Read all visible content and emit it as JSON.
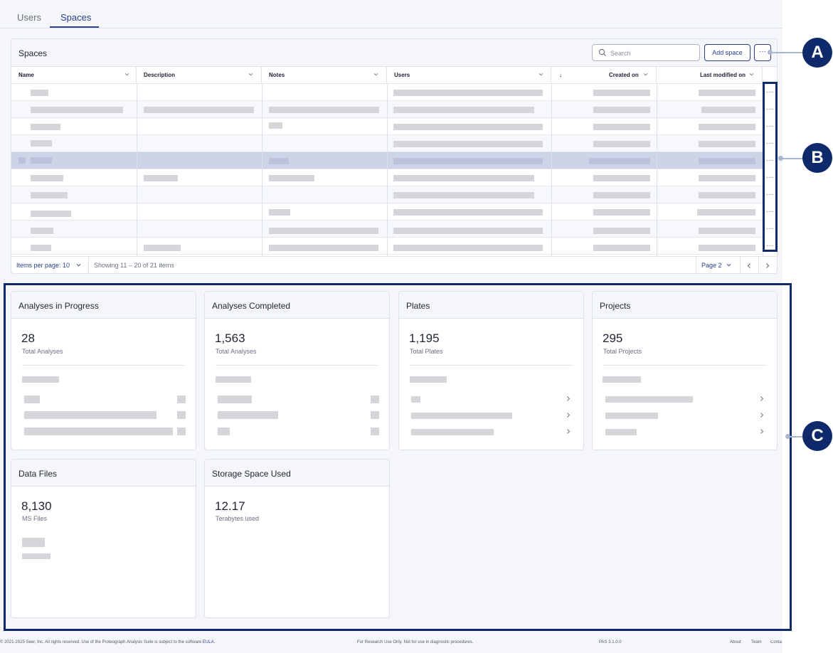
{
  "tabs": {
    "users": "Users",
    "spaces": "Spaces"
  },
  "spaces_panel": {
    "title": "Spaces",
    "search_placeholder": "Search",
    "add_space_label": "Add space",
    "more_label": "···",
    "columns": {
      "name": "Name",
      "description": "Description",
      "notes": "Notes",
      "users": "Users",
      "sort_indicator": "↓",
      "created_on": "Created on",
      "last_modified_on": "Last modified on"
    },
    "row_menu_label": "···",
    "items_per_page": "Items per page: 10",
    "showing": "Showing 11 – 20 of 21 items",
    "page": "Page 2"
  },
  "cards": {
    "analyses_in_progress": {
      "title": "Analyses in Progress",
      "value": "28",
      "sub": "Total Analyses"
    },
    "analyses_completed": {
      "title": "Analyses Completed",
      "value": "1,563",
      "sub": "Total Analyses"
    },
    "plates": {
      "title": "Plates",
      "value": "1,195",
      "sub": "Total Plates"
    },
    "projects": {
      "title": "Projects",
      "value": "295",
      "sub": "Total Projects"
    },
    "data_files": {
      "title": "Data Files",
      "value": "8,130",
      "sub": "MS Files"
    },
    "storage": {
      "title": "Storage Space Used",
      "value": "12.17",
      "sub": "Terabytes used"
    }
  },
  "footer": {
    "copyright": "© 2021-2025 Seer, Inc. All rights reserved. Use of the Proteograph Analysis Suite is subject to the software",
    "eula": "EULA.",
    "research_use": "For Research Use Only. Not for use in diagnostic procedures.",
    "version": "PAS 3.1.0.0",
    "about": "About",
    "team": "Team",
    "contact": "Conta"
  },
  "callouts": {
    "a": "A",
    "b": "B",
    "c": "C"
  },
  "colors": {
    "primary": "#2b3f8c",
    "callout": "#0e2a6b",
    "selected_row": "#cdd4e8",
    "placeholder_bar": "#d4d6da"
  }
}
